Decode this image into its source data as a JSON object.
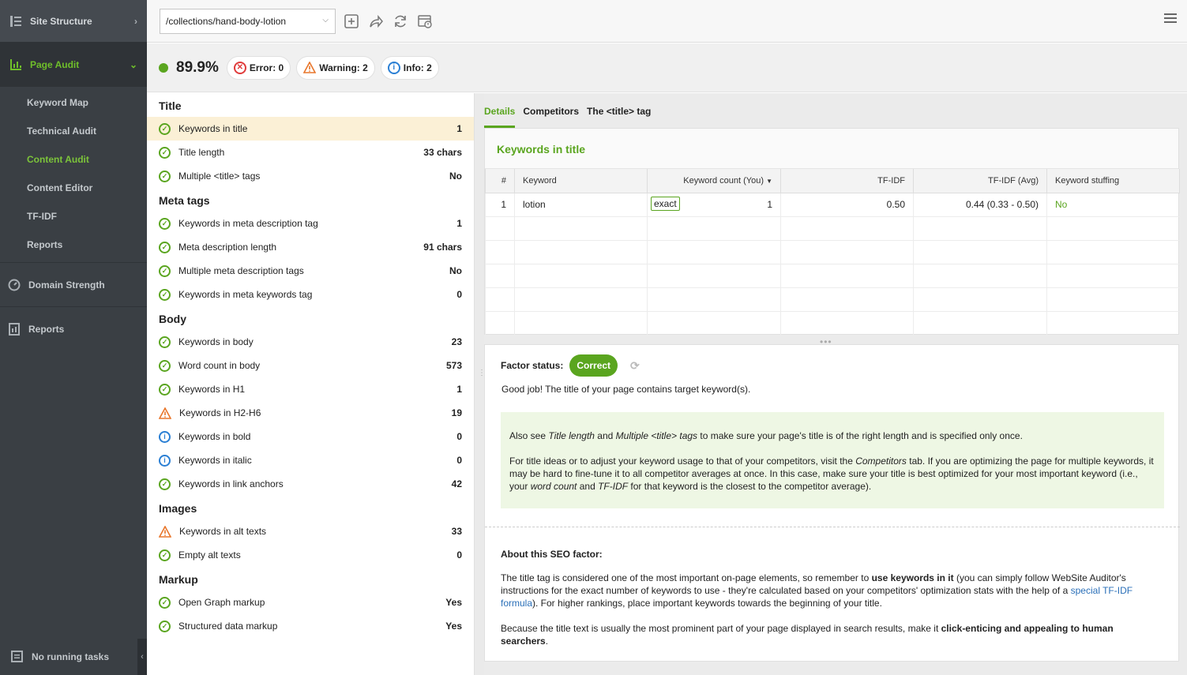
{
  "sidebar": {
    "site_structure": "Site Structure",
    "page_audit": "Page Audit",
    "sub_items": [
      "Keyword Map",
      "Technical Audit",
      "Content Audit",
      "Content Editor",
      "TF-IDF",
      "Reports"
    ],
    "domain_strength": "Domain Strength",
    "reports": "Reports",
    "running_tasks": "No running tasks"
  },
  "toolbar": {
    "url": "/collections/hand-body-lotion"
  },
  "scorebar": {
    "score": "89.9%",
    "error": "Error: 0",
    "warning": "Warning: 2",
    "info": "Info: 2"
  },
  "factors": {
    "title_h": "Title",
    "title_rows": [
      {
        "label": "Keywords in title",
        "value": "1"
      },
      {
        "label": "Title length",
        "value": "33 chars"
      },
      {
        "label": "Multiple <title> tags",
        "value": "No"
      }
    ],
    "meta_h": "Meta tags",
    "meta_rows": [
      {
        "label": "Keywords in meta description tag",
        "value": "1"
      },
      {
        "label": "Meta description length",
        "value": "91 chars"
      },
      {
        "label": "Multiple meta description tags",
        "value": "No"
      },
      {
        "label": "Keywords in meta keywords tag",
        "value": "0"
      }
    ],
    "body_h": "Body",
    "body_rows": [
      {
        "label": "Keywords in body",
        "value": "23"
      },
      {
        "label": "Word count in body",
        "value": "573"
      },
      {
        "label": "Keywords in H1",
        "value": "1"
      },
      {
        "label": "Keywords in H2-H6",
        "value": "19"
      },
      {
        "label": "Keywords in bold",
        "value": "0"
      },
      {
        "label": "Keywords in italic",
        "value": "0"
      },
      {
        "label": "Keywords in link anchors",
        "value": "42"
      }
    ],
    "images_h": "Images",
    "images_rows": [
      {
        "label": "Keywords in alt texts",
        "value": "33"
      },
      {
        "label": "Empty alt texts",
        "value": "0"
      }
    ],
    "markup_h": "Markup",
    "markup_rows": [
      {
        "label": "Open Graph markup",
        "value": "Yes"
      },
      {
        "label": "Structured data markup",
        "value": "Yes"
      }
    ]
  },
  "tabs": [
    "Details",
    "Competitors",
    "The <title> tag"
  ],
  "card": {
    "title": "Keywords in title",
    "headers": [
      "#",
      "Keyword",
      "Keyword count (You)",
      "TF-IDF",
      "TF-IDF (Avg)",
      "Keyword stuffing"
    ],
    "row": {
      "n": "1",
      "keyword": "lotion",
      "match": "exact",
      "count": "1",
      "tfidf": "0.50",
      "tfidf_avg": "0.44 (0.33 - 0.50)",
      "stuffing": "No"
    }
  },
  "detail": {
    "factor_label": "Factor status:",
    "status": "Correct",
    "message": "Good job! The title of your page contains target keyword(s).",
    "tip1_a": "Also see ",
    "tip1_b": "Title length",
    "tip1_c": " and ",
    "tip1_d": "Multiple <title> tags",
    "tip1_e": " to make sure your page's title is of the right length and is specified only once.",
    "tip2_a": "For title ideas or to adjust your keyword usage to that of your competitors, visit the ",
    "tip2_b": "Competitors",
    "tip2_c": " tab. If you are optimizing the page for multiple keywords, it may be hard to fine-tune it to all competitor averages at once. In this case, make sure your title is best optimized for your most important keyword (i.e., your ",
    "tip2_d": "word count",
    "tip2_e": " and ",
    "tip2_f": "TF-IDF",
    "tip2_g": " for that keyword is the closest to the competitor average).",
    "about_h": "About this SEO factor:",
    "about1_a": "The title tag is considered one of the most important on-page elements, so remember to ",
    "about1_b": "use keywords in it",
    "about1_c": " (you can simply follow WebSite Auditor's instructions for the exact number of keywords to use - they're calculated based on your competitors' optimization stats with the help of a ",
    "about1_link": "special TF-IDF formula",
    "about1_d": "). For higher rankings, place important keywords towards the beginning of your title.",
    "about2_a": "Because the title text is usually the most prominent part of your page displayed in search results, make it ",
    "about2_b": "click-enticing and appealing to human searchers",
    "about2_c": "."
  }
}
